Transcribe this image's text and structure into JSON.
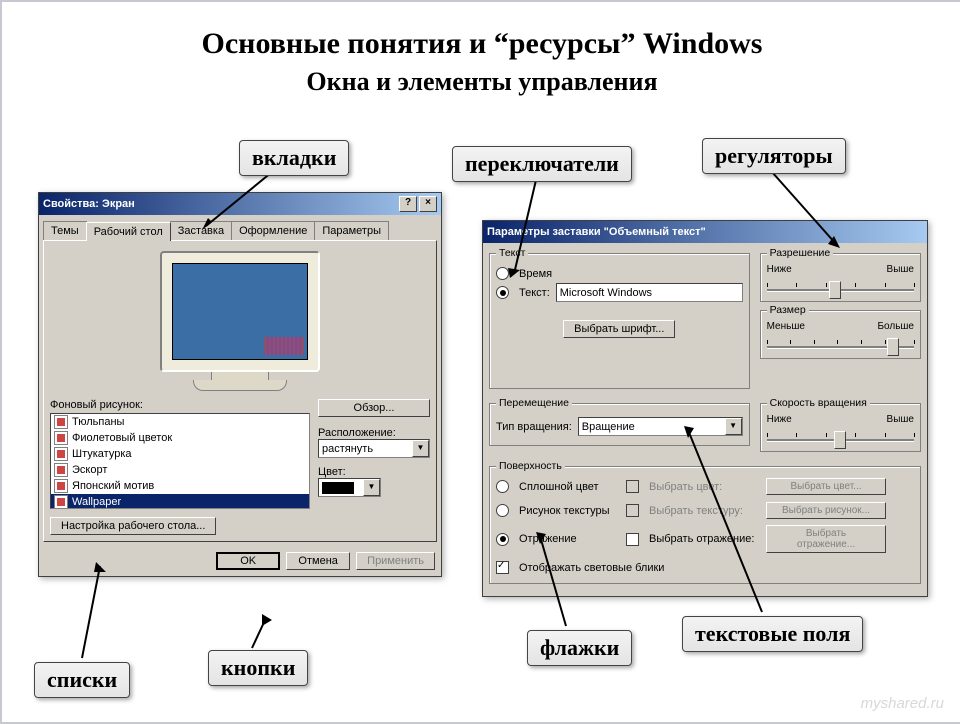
{
  "headings": {
    "main": "Основные понятия   и “ресурсы” Windows",
    "sub": "Окна и элементы управления"
  },
  "callouts": {
    "tabs": "вкладки",
    "radios": "переключатели",
    "sliders": "регуляторы",
    "lists": "списки",
    "buttons": "кнопки",
    "checkboxes": "флажки",
    "textfields": "текстовые поля"
  },
  "dialog1": {
    "title": "Свойства: Экран",
    "help_btn": "?",
    "close_btn": "×",
    "tabs": [
      "Темы",
      "Рабочий стол",
      "Заставка",
      "Оформление",
      "Параметры"
    ],
    "active_tab": 1,
    "bg_label": "Фоновый рисунок:",
    "bg_items": [
      "Тюльпаны",
      "Фиолетовый цветок",
      "Штукатурка",
      "Эскорт",
      "Японский мотив",
      "Wallpaper"
    ],
    "bg_selected": 5,
    "browse": "Обзор...",
    "placement_label": "Расположение:",
    "placement_value": "растянуть",
    "color_label": "Цвет:",
    "customize": "Настройка рабочего стола...",
    "ok": "OK",
    "cancel": "Отмена",
    "apply": "Применить"
  },
  "dialog2": {
    "title": "Параметры заставки \"Объемный текст\"",
    "g_text": "Текст",
    "radio_time": "Время",
    "radio_text": "Текст:",
    "text_value": "Microsoft Windows",
    "choose_font": "Выбрать шрифт...",
    "g_resolution": "Разрешение",
    "res_low": "Ниже",
    "res_high": "Выше",
    "g_size": "Размер",
    "size_low": "Меньше",
    "size_high": "Больше",
    "g_motion": "Перемещение",
    "rot_type_label": "Тип вращения:",
    "rot_type_value": "Вращение",
    "g_speed": "Скорость вращения",
    "speed_low": "Ниже",
    "speed_high": "Выше",
    "g_surface": "Поверхность",
    "surf_solid": "Сплошной цвет",
    "surf_texture": "Рисунок текстуры",
    "surf_reflect": "Отражение",
    "cb_choose_color": "Выбрать цвет:",
    "cb_choose_texture": "Выбрать текстуру:",
    "cb_choose_reflect": "Выбрать отражение:",
    "cb_specular": "Отображать световые блики",
    "btn_color": "Выбрать цвет...",
    "btn_texture": "Выбрать рисунок...",
    "btn_reflect": "Выбрать отражение..."
  },
  "watermark": "myshared.ru"
}
